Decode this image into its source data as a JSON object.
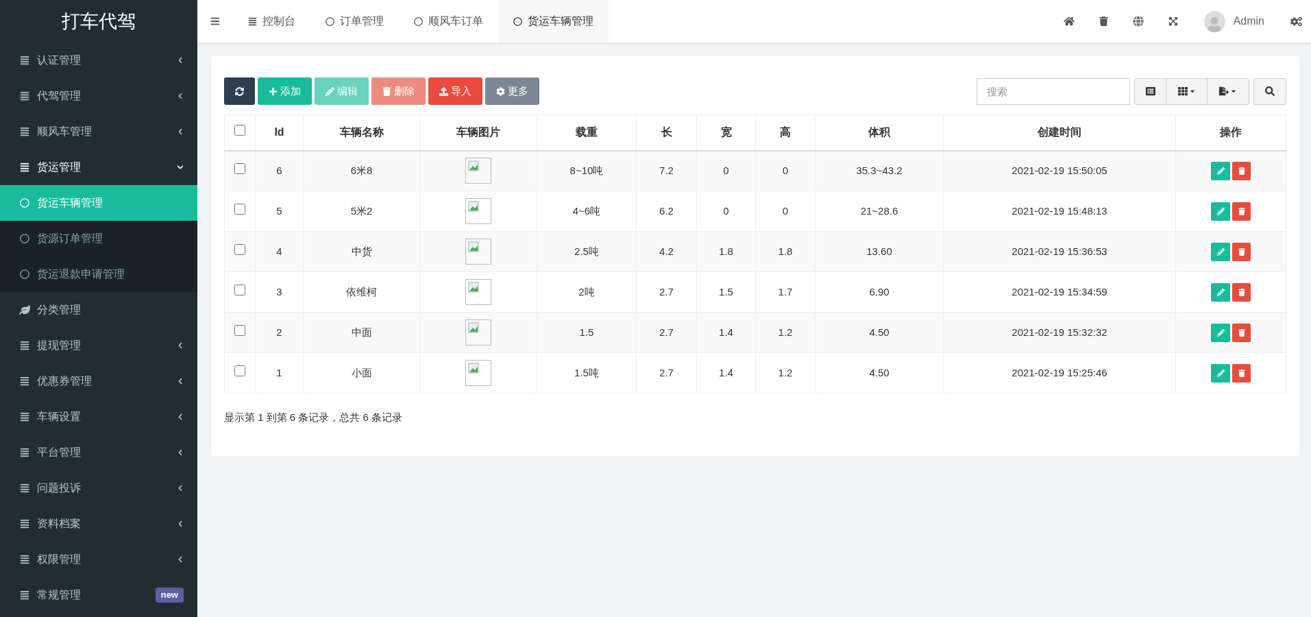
{
  "logo": "打车代驾",
  "sidebar": {
    "items": [
      {
        "label": "认证管理",
        "kind": "menu",
        "expanded": false,
        "selected": false
      },
      {
        "label": "代驾管理",
        "kind": "menu",
        "expanded": false,
        "selected": false
      },
      {
        "label": "顺风车管理",
        "kind": "menu",
        "expanded": false,
        "selected": false
      },
      {
        "label": "货运管理",
        "kind": "menu",
        "expanded": true,
        "selected": false,
        "children": [
          {
            "label": "货运车辆管理",
            "selected": true
          },
          {
            "label": "货源订单管理",
            "selected": false
          },
          {
            "label": "货运退款申请管理",
            "selected": false
          }
        ]
      },
      {
        "label": "分类管理",
        "kind": "plain",
        "selected": false
      },
      {
        "label": "提现管理",
        "kind": "menu",
        "expanded": false,
        "selected": false
      },
      {
        "label": "优惠券管理",
        "kind": "menu",
        "expanded": false,
        "selected": false
      },
      {
        "label": "车辆设置",
        "kind": "menu",
        "expanded": false,
        "selected": false
      },
      {
        "label": "平台管理",
        "kind": "menu",
        "expanded": false,
        "selected": false
      },
      {
        "label": "问题投诉",
        "kind": "menu",
        "expanded": false,
        "selected": false
      },
      {
        "label": "资料档案",
        "kind": "menu",
        "expanded": false,
        "selected": false
      },
      {
        "label": "权限管理",
        "kind": "menu",
        "expanded": false,
        "selected": false
      },
      {
        "label": "常规管理",
        "kind": "menu",
        "badge": "new",
        "selected": false
      }
    ]
  },
  "tabs": [
    {
      "label": "控制台",
      "kind": "dashboard",
      "selected": false
    },
    {
      "label": "订单管理",
      "kind": "page",
      "selected": false
    },
    {
      "label": "顺风车订单",
      "kind": "page",
      "selected": false
    },
    {
      "label": "货运车辆管理",
      "kind": "page",
      "selected": true
    }
  ],
  "user": {
    "name": "Admin"
  },
  "toolbar": [
    {
      "kind": "refresh",
      "disabled": false
    },
    {
      "kind": "add",
      "label": "添加",
      "disabled": false
    },
    {
      "kind": "edit",
      "label": "编辑",
      "disabled": true
    },
    {
      "kind": "delete",
      "label": "删除",
      "disabled": true
    },
    {
      "kind": "import",
      "label": "导入",
      "disabled": false
    },
    {
      "kind": "more",
      "label": "更多",
      "disabled": false
    }
  ],
  "search": {
    "placeholder": "搜索"
  },
  "table": {
    "header_checked": false,
    "columns": [
      "Id",
      "车辆名称",
      "车辆图片",
      "载重",
      "长",
      "宽",
      "高",
      "体积",
      "创建时间",
      "操作"
    ],
    "rows": [
      {
        "checked": false,
        "cells": [
          "6",
          "6米8",
          "",
          "8~10吨",
          "7.2",
          "0",
          "0",
          "35.3~43.2",
          "2021-02-19 15:50:05"
        ]
      },
      {
        "checked": false,
        "cells": [
          "5",
          "5米2",
          "",
          "4~6吨",
          "6.2",
          "0",
          "0",
          "21~28.6",
          "2021-02-19 15:48:13"
        ]
      },
      {
        "checked": false,
        "cells": [
          "4",
          "中货",
          "",
          "2.5吨",
          "4.2",
          "1.8",
          "1.8",
          "13.60",
          "2021-02-19 15:36:53"
        ]
      },
      {
        "checked": false,
        "cells": [
          "3",
          "依维柯",
          "",
          "2吨",
          "2.7",
          "1.5",
          "1.7",
          "6.90",
          "2021-02-19 15:34:59"
        ]
      },
      {
        "checked": false,
        "cells": [
          "2",
          "中面",
          "",
          "1.5",
          "2.7",
          "1.4",
          "1.2",
          "4.50",
          "2021-02-19 15:32:32"
        ]
      },
      {
        "checked": false,
        "cells": [
          "1",
          "小面",
          "",
          "1.5吨",
          "2.7",
          "1.4",
          "1.2",
          "4.50",
          "2021-02-19 15:25:46"
        ]
      }
    ]
  },
  "pagination": {
    "summary": "显示第 1 到第 6 条记录，总共 6 条记录"
  }
}
